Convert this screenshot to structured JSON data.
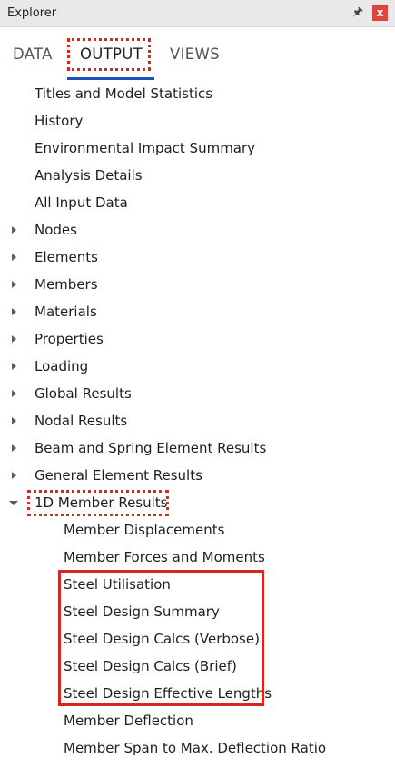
{
  "window": {
    "title": "Explorer",
    "pin_icon": "pin-icon",
    "close_icon": "close-icon"
  },
  "tabs": [
    {
      "label": "DATA",
      "active": false
    },
    {
      "label": "OUTPUT",
      "active": true
    },
    {
      "label": "VIEWS",
      "active": false
    }
  ],
  "tree": {
    "plain": [
      "Titles and Model Statistics",
      "History",
      "Environmental Impact Summary",
      "Analysis Details",
      "All Input Data"
    ],
    "collapsed": [
      "Nodes",
      "Elements",
      "Members",
      "Materials",
      "Properties",
      "Loading",
      "Global Results",
      "Nodal Results",
      "Beam and Spring Element Results",
      "General Element Results"
    ],
    "expanded": {
      "label": "1D Member Results",
      "children": [
        "Member Displacements",
        "Member Forces and Moments",
        "Steel Utilisation",
        "Steel Design Summary",
        "Steel Design Calcs (Verbose)",
        "Steel Design Calcs (Brief)",
        "Steel Design Effective Lengths",
        "Member Deflection",
        "Member Span to Max. Deflection Ratio"
      ]
    }
  },
  "colors": {
    "highlight": "#d7261e",
    "active_tab": "#1f4fb5"
  }
}
